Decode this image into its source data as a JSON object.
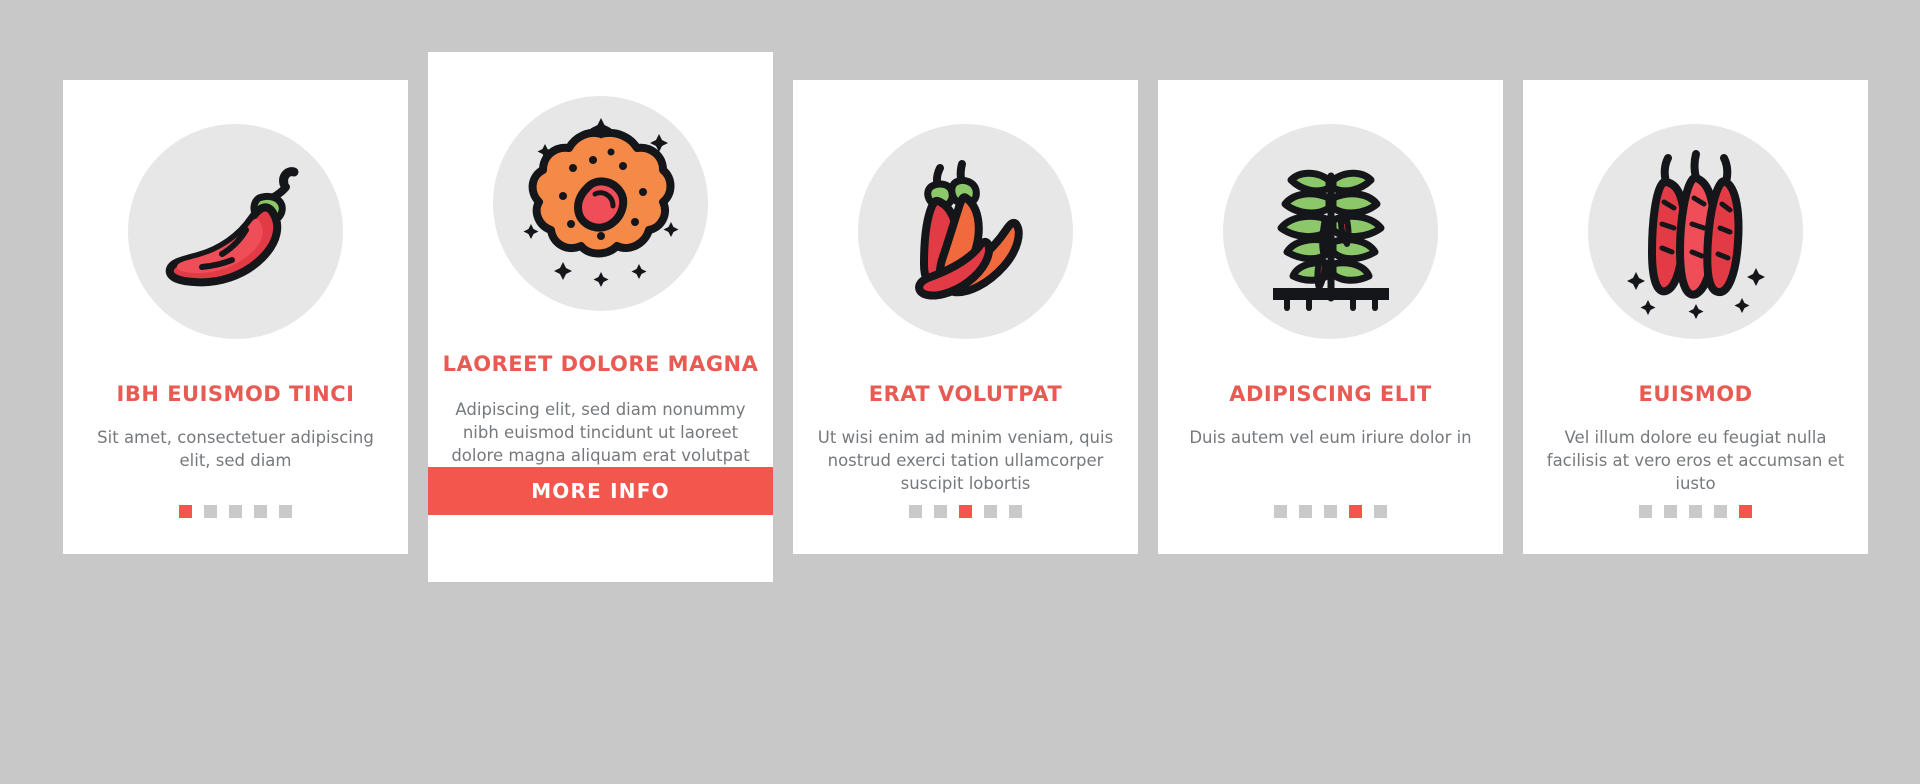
{
  "theme": {
    "background": "#c8c8c8",
    "card_background": "#ffffff",
    "accent": "#f2564d",
    "title_color": "#e85a52",
    "body_color": "#76797c",
    "circle_color": "#e7e7e7",
    "dot_inactive": "#c9c9c9"
  },
  "cards": [
    {
      "icon": "chili-pepper-single-icon",
      "title": "IBH EUISMOD TINCI",
      "body": "Sit amet, consectetuer adipiscing elit, sed diam",
      "pagination": {
        "count": 5,
        "active_index": 0
      },
      "featured": false
    },
    {
      "icon": "chili-flakes-pile-icon",
      "title": "LAOREET DOLORE MAGNA",
      "body": "Adipiscing elit, sed diam nonummy nibh euismod tincidunt ut laoreet dolore magna aliquam erat volutpat",
      "cta_label": "MORE INFO",
      "featured": true
    },
    {
      "icon": "chili-peppers-group-icon",
      "title": "ERAT VOLUTPAT",
      "body": "Ut wisi enim ad minim veniam, quis nostrud exerci tation ullamcorper suscipit lobortis",
      "pagination": {
        "count": 5,
        "active_index": 2
      },
      "featured": false
    },
    {
      "icon": "chili-plant-icon",
      "title": "ADIPISCING ELIT",
      "body": "Duis autem vel eum iriure dolor in",
      "pagination": {
        "count": 5,
        "active_index": 3
      },
      "featured": false
    },
    {
      "icon": "dried-chili-peppers-icon",
      "title": "EUISMOD",
      "body": "Vel illum dolore eu feugiat nulla facilisis at vero eros et accumsan et iusto",
      "pagination": {
        "count": 5,
        "active_index": 4
      },
      "featured": false
    }
  ]
}
